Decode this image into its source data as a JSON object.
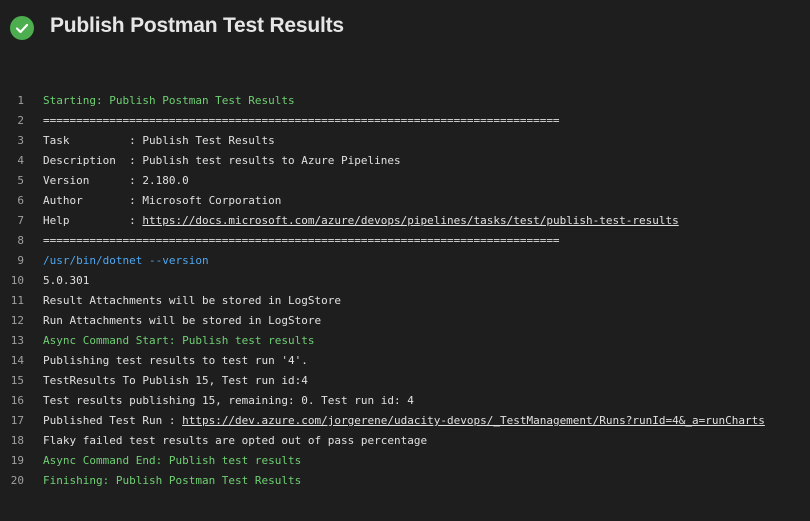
{
  "header": {
    "status_icon": "check-circle-icon",
    "status_color": "#4cae4f",
    "title": "Publish Postman Test Results"
  },
  "log": {
    "lines": [
      {
        "n": "1",
        "kind": "section",
        "text": "Starting: Publish Postman Test Results"
      },
      {
        "n": "2",
        "kind": "normal",
        "text": "=============================================================================="
      },
      {
        "n": "3",
        "kind": "normal",
        "text": "Task         : Publish Test Results"
      },
      {
        "n": "4",
        "kind": "normal",
        "text": "Description  : Publish test results to Azure Pipelines"
      },
      {
        "n": "5",
        "kind": "normal",
        "text": "Version      : 2.180.0"
      },
      {
        "n": "6",
        "kind": "normal",
        "text": "Author       : Microsoft Corporation"
      },
      {
        "n": "7",
        "kind": "normal",
        "text": "Help         : ",
        "link": "https://docs.microsoft.com/azure/devops/pipelines/tasks/test/publish-test-results"
      },
      {
        "n": "8",
        "kind": "normal",
        "text": "=============================================================================="
      },
      {
        "n": "9",
        "kind": "command",
        "text": "/usr/bin/dotnet --version"
      },
      {
        "n": "10",
        "kind": "normal",
        "text": "5.0.301"
      },
      {
        "n": "11",
        "kind": "normal",
        "text": "Result Attachments will be stored in LogStore"
      },
      {
        "n": "12",
        "kind": "normal",
        "text": "Run Attachments will be stored in LogStore"
      },
      {
        "n": "13",
        "kind": "section",
        "text": "Async Command Start: Publish test results"
      },
      {
        "n": "14",
        "kind": "normal",
        "text": "Publishing test results to test run '4'."
      },
      {
        "n": "15",
        "kind": "normal",
        "text": "TestResults To Publish 15, Test run id:4"
      },
      {
        "n": "16",
        "kind": "normal",
        "text": "Test results publishing 15, remaining: 0. Test run id: 4"
      },
      {
        "n": "17",
        "kind": "normal",
        "text": "Published Test Run : ",
        "link": "https://dev.azure.com/jorgerene/udacity-devops/_TestManagement/Runs?runId=4&_a=runCharts"
      },
      {
        "n": "18",
        "kind": "normal",
        "text": "Flaky failed test results are opted out of pass percentage"
      },
      {
        "n": "19",
        "kind": "section",
        "text": "Async Command End: Publish test results"
      },
      {
        "n": "20",
        "kind": "section",
        "text": "Finishing: Publish Postman Test Results"
      }
    ]
  }
}
